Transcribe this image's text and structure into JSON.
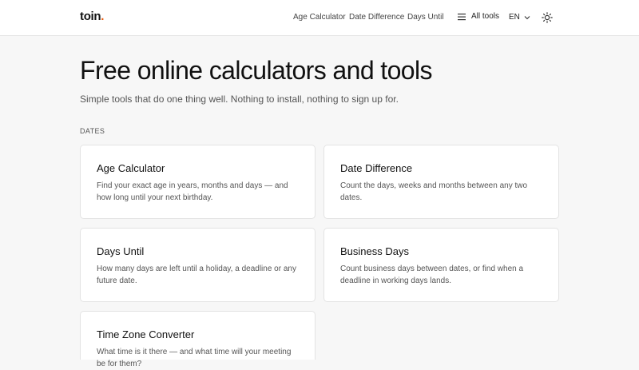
{
  "header": {
    "logo": "toin",
    "logo_dot": ".",
    "nav": [
      "Age Calculator",
      "Date Difference",
      "Days Until"
    ],
    "all_tools": "All tools",
    "language": "EN",
    "icons": {
      "menu": "hamburger-icon",
      "language": "chevron-down-icon",
      "theme": "sun-icon"
    }
  },
  "hero": {
    "title": "Free online calculators and tools",
    "subtitle": "Simple tools that do one thing well. Nothing to install, nothing to sign up for."
  },
  "section": {
    "label": "DATES",
    "cards": [
      {
        "title": "Age Calculator",
        "desc": "Find your exact age in years, months and days — and how long until your next birthday."
      },
      {
        "title": "Date Difference",
        "desc": "Count the days, weeks and months between any two dates."
      },
      {
        "title": "Days Until",
        "desc": "How many days are left until a holiday, a deadline or any future date."
      },
      {
        "title": "Business Days",
        "desc": "Count business days between dates, or find when a deadline in working days lands."
      },
      {
        "title": "Time Zone Converter",
        "desc": "What time is it there — and what time will your meeting be for them?"
      }
    ]
  },
  "colors": {
    "accent": "#e8590c",
    "background": "#f7f7f7",
    "card": "#ffffff",
    "border": "#e3e3e3"
  }
}
